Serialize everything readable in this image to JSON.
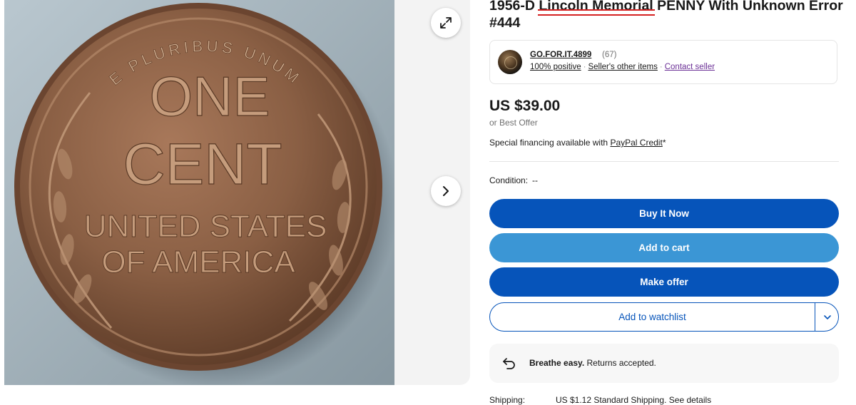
{
  "listing": {
    "title_prefix": "1956-D ",
    "title_highlight": "Lincoln Memorial",
    "title_suffix": " PENNY With Unknown Error #444"
  },
  "gallery": {
    "coin_text": [
      "E PLURIBUS UNUM",
      "ONE",
      "CENT",
      "UNITED STATES",
      "OF AMERICA"
    ],
    "expand_icon": "expand-icon",
    "next_icon": "chevron-right-icon"
  },
  "seller": {
    "name": "GO.FOR.IT.4899",
    "count": "(67)",
    "positive": "100% positive",
    "other_items": "Seller's other items",
    "contact": "Contact seller",
    "separator": "·"
  },
  "pricing": {
    "price": "US $39.00",
    "best_offer": "or Best Offer",
    "financing_prefix": "Special financing available with ",
    "financing_link": "PayPal Credit",
    "financing_suffix": "*"
  },
  "condition": {
    "label": "Condition:",
    "value": "--"
  },
  "actions": {
    "buy_now": "Buy It Now",
    "add_to_cart": "Add to cart",
    "make_offer": "Make offer",
    "watchlist": "Add to watchlist"
  },
  "returns": {
    "bold": "Breathe easy.",
    "rest": " Returns accepted."
  },
  "shipping": {
    "label": "Shipping:",
    "value": "US $1.12 Standard Shipping. See details"
  },
  "colors": {
    "primary_blue": "#0654ba",
    "cart_blue": "#3b96d5",
    "link_purple": "#6b3096",
    "highlight_red": "#d42222"
  }
}
